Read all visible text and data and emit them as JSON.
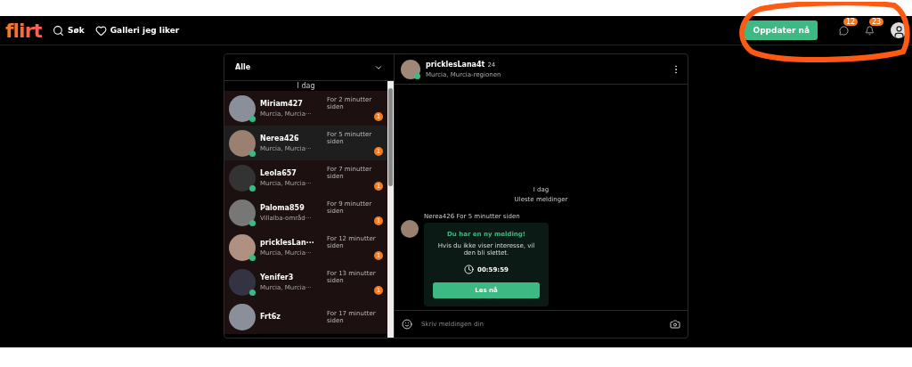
{
  "header": {
    "logo": "flirt",
    "nav": [
      {
        "kind": "search",
        "label": "Søk"
      },
      {
        "kind": "heart",
        "label": "Galleri jeg liker"
      }
    ],
    "upgrade_button": "Oppdater nå",
    "notifications": [
      {
        "kind": "chat",
        "count": "12"
      },
      {
        "kind": "bell",
        "count": "23"
      }
    ]
  },
  "sidebar": {
    "filter": "Alle",
    "day": "I dag",
    "conversations": [
      {
        "name": "Miriam427",
        "location": "Murcia, Murcia···",
        "time": "For 2 minutter siden",
        "unread": "1",
        "online": true,
        "selected": false
      },
      {
        "name": "Nerea426",
        "location": "Murcia, Murcia···",
        "time": "For 5 minutter siden",
        "unread": "1",
        "online": true,
        "selected": true
      },
      {
        "name": "Leola657",
        "location": "Murcia, Murcia···",
        "time": "For 7 minutter siden",
        "unread": "1",
        "online": true,
        "selected": false
      },
      {
        "name": "Paloma859",
        "location": "Villalba-områd···",
        "time": "For 9 minutter siden",
        "unread": "1",
        "online": true,
        "selected": false
      },
      {
        "name": "pricklesLan···",
        "location": "Murcia, Murcia···",
        "time": "For 12 minutter siden",
        "unread": "1",
        "online": true,
        "selected": false
      },
      {
        "name": "Yenifer3",
        "location": "Murcia, Murcia···",
        "time": "For 13 minutter siden",
        "unread": "1",
        "online": true,
        "selected": false
      },
      {
        "name": "Frt6z",
        "time": "For 17 minutter siden",
        "online": false,
        "selected": false
      }
    ]
  },
  "chat": {
    "name": "pricklesLana4t",
    "age": "24",
    "location": "Murcia, Murcia-regionen",
    "online": true,
    "day": "I dag",
    "unread_label": "Uleste meldinger",
    "message": {
      "sender": "Nerea426",
      "time": "For 5 minutter siden",
      "title": "Du har en ny melding!",
      "body": "Hvis du ikke viser interesse, vil den bli slettet.",
      "timer": "00:59:59",
      "button": "Les nå"
    },
    "composer": {
      "placeholder": "Skriv meldingen din"
    }
  }
}
